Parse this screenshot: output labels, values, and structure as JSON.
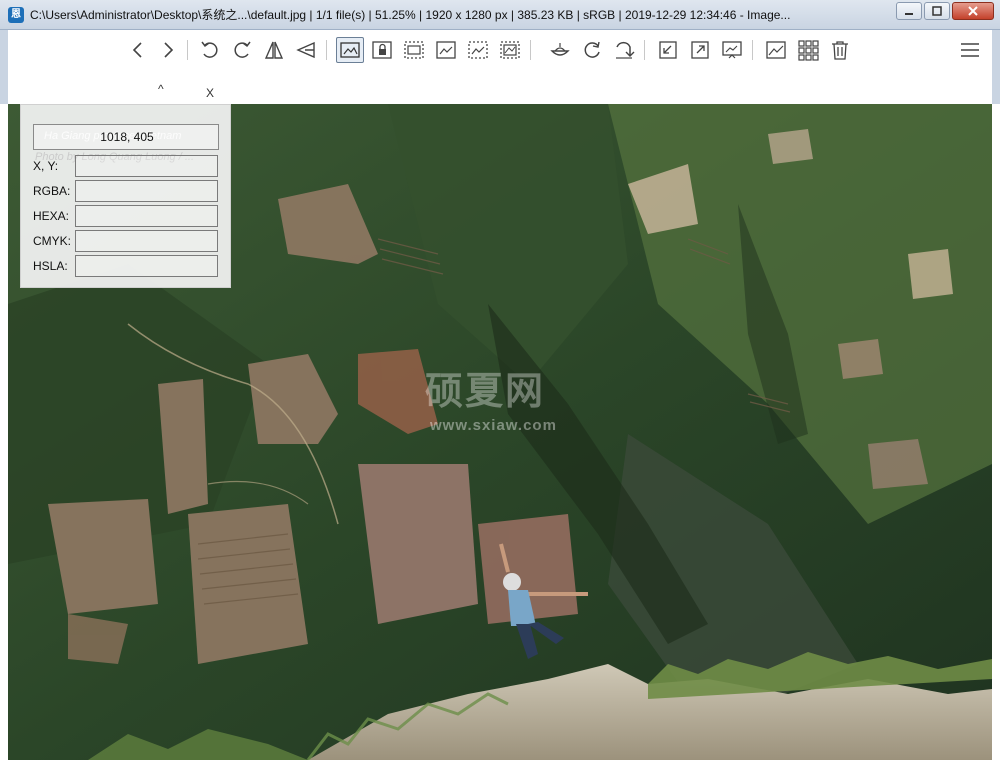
{
  "window": {
    "title": "C:\\Users\\Administrator\\Desktop\\系统之...\\default.jpg  |  1/1 file(s)  |  51.25%  |  1920 x 1280 px  |  385.23 KB  |  sRGB  |  2019-12-29 12:34:46  - Image...",
    "app_icon_glyph": "恩"
  },
  "toolbar": {
    "icons": [
      "back-icon",
      "forward-icon",
      "rotate-left-icon",
      "rotate-right-icon",
      "flip-horizontal-icon",
      "flip-vertical-icon",
      "fit-view-icon",
      "lock-zoom-icon",
      "scale-to-width-icon",
      "scale-to-height-icon",
      "scale-to-fit-icon",
      "scale-to-fill-icon",
      "checkerboard-icon",
      "refresh-icon",
      "goto-icon",
      "color-picker-icon",
      "fullscreen-icon",
      "slideshow-icon",
      "set-wallpaper-icon",
      "thumbnail-bar-icon",
      "delete-icon",
      "menu-icon"
    ],
    "active": "fit-view-icon"
  },
  "subbar": {
    "caret": "^",
    "close": "X"
  },
  "picker": {
    "coordinates": "1018, 405",
    "ghost_caption": "Ha Giang province, Vietnam",
    "ghost_credit": "Photo by Long Quang Luong / ...",
    "labels": {
      "xy": "X, Y:",
      "rgba": "RGBA:",
      "hexa": "HEXA:",
      "cmyk": "CMYK:",
      "hsla": "HSLA:"
    }
  },
  "watermark": {
    "main": "硕夏网",
    "sub": "www.sxiaw.com"
  }
}
